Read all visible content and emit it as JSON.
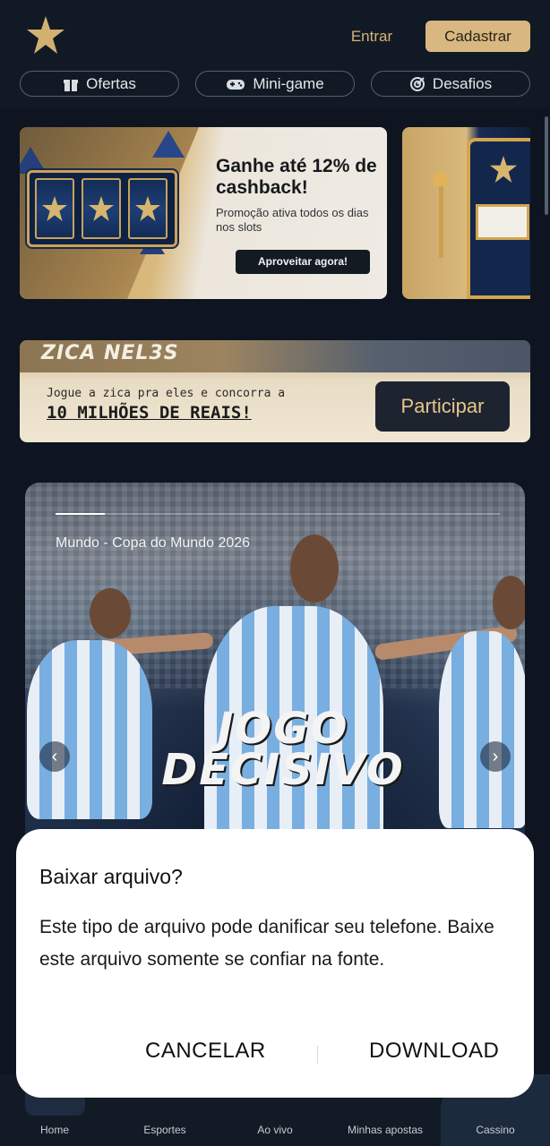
{
  "header": {
    "logo": "star-logo",
    "login_label": "Entrar",
    "signup_label": "Cadastrar",
    "pills": [
      {
        "label": "Ofertas",
        "icon": "gift-icon"
      },
      {
        "label": "Mini-game",
        "icon": "gamepad-icon"
      },
      {
        "label": "Desafios",
        "icon": "target-icon"
      }
    ]
  },
  "promo": {
    "title": "Ganhe até 12% de cashback!",
    "subtitle": "Promoção ativa todos os dias nos slots",
    "cta": "Aproveitar agora!"
  },
  "zica": {
    "logo": "ZICA NEL3S",
    "line1": "Jogue a zica pra eles e concorra a",
    "line2": "10 MILHÕES DE REAIS!",
    "button": "Participar"
  },
  "hero": {
    "caption": "Mundo - Copa do Mundo 2026",
    "title": "JOGO DECISIVO",
    "slide_progress": 0.11
  },
  "bottom_nav": [
    {
      "label": "Home",
      "icon": "home-icon"
    },
    {
      "label": "Esportes",
      "icon": "soccer-ball-icon"
    },
    {
      "label": "Ao vivo",
      "icon": "live-icon"
    },
    {
      "label": "Minhas apostas",
      "icon": "ticket-icon"
    },
    {
      "label": "Cassino",
      "icon": "slot-machine-icon"
    }
  ],
  "dialog": {
    "title": "Baixar arquivo?",
    "body": "Este tipo de arquivo pode danificar seu telefone. Baixe este arquivo somente se confiar na fonte.",
    "cancel": "CANCELAR",
    "download": "DOWNLOAD"
  },
  "colors": {
    "background": "#0f1620",
    "accent": "#d8b880",
    "dialog": "#ffffff"
  }
}
